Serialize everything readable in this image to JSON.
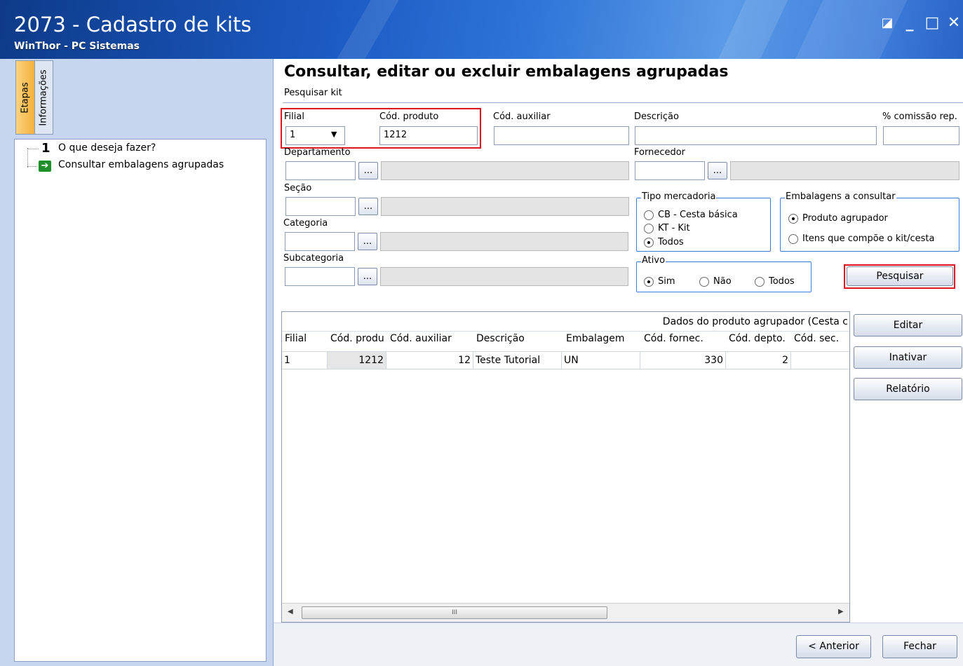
{
  "window": {
    "title": "2073 - Cadastro de kits",
    "subtitle": "WinThor - PC Sistemas",
    "controls": {
      "restore": "◪",
      "minimize": "_",
      "maximize": "□",
      "close": "✕"
    }
  },
  "side_tabs": {
    "etapas": "Etapas",
    "informacoes": "Informações"
  },
  "steps": {
    "step1_number": "1",
    "step1_label": "O que deseja fazer?",
    "step2_icon": "➔",
    "step2_label": "Consultar embalagens agrupadas"
  },
  "page": {
    "title": "Consultar, editar ou excluir embalagens agrupadas",
    "subtitle": "Pesquisar kit"
  },
  "form": {
    "filial_label": "Filial",
    "filial_value": "1",
    "filial_arrow": "▼",
    "cod_produto_label": "Cód. produto",
    "cod_produto_value": "1212",
    "cod_auxiliar_label": "Cód. auxiliar",
    "descricao_label": "Descrição",
    "comissao_label": "% comissão rep.",
    "departamento_label": "Departamento",
    "fornecedor_label": "Fornecedor",
    "secao_label": "Seção",
    "categoria_label": "Categoria",
    "subcategoria_label": "Subcategoria",
    "lookup_button": "...",
    "tipo_mercadoria": {
      "label": "Tipo mercadoria",
      "options": [
        "CB - Cesta básica",
        "KT - Kit",
        "Todos"
      ],
      "selected": "Todos"
    },
    "embalagens_consultar": {
      "label": "Embalagens a consultar",
      "options": [
        "Produto agrupador",
        "Itens que compõe o kit/cesta"
      ],
      "selected": "Produto agrupador"
    },
    "ativo": {
      "label": "Ativo",
      "options": [
        "Sim",
        "Não",
        "Todos"
      ],
      "selected": "Sim"
    },
    "pesquisar_button": "Pesquisar"
  },
  "grid": {
    "band_title": "Dados do produto agrupador (Cesta c",
    "columns": [
      "Filial",
      "Cód. produ",
      "Cód. auxiliar",
      "Descrição",
      "Embalagem",
      "Cód. fornec.",
      "Cód. depto.",
      "Cód. sec."
    ],
    "rows": [
      [
        "1",
        "1212",
        "12",
        "Teste Tutorial",
        "UN",
        "330",
        "2",
        ""
      ]
    ],
    "scroll_left": "◀",
    "scroll_right": "▶",
    "scroll_grip": "III"
  },
  "actions": {
    "editar": "Editar",
    "inativar": "Inativar",
    "relatorio": "Relatório",
    "anterior": "< Anterior",
    "fechar": "Fechar"
  }
}
